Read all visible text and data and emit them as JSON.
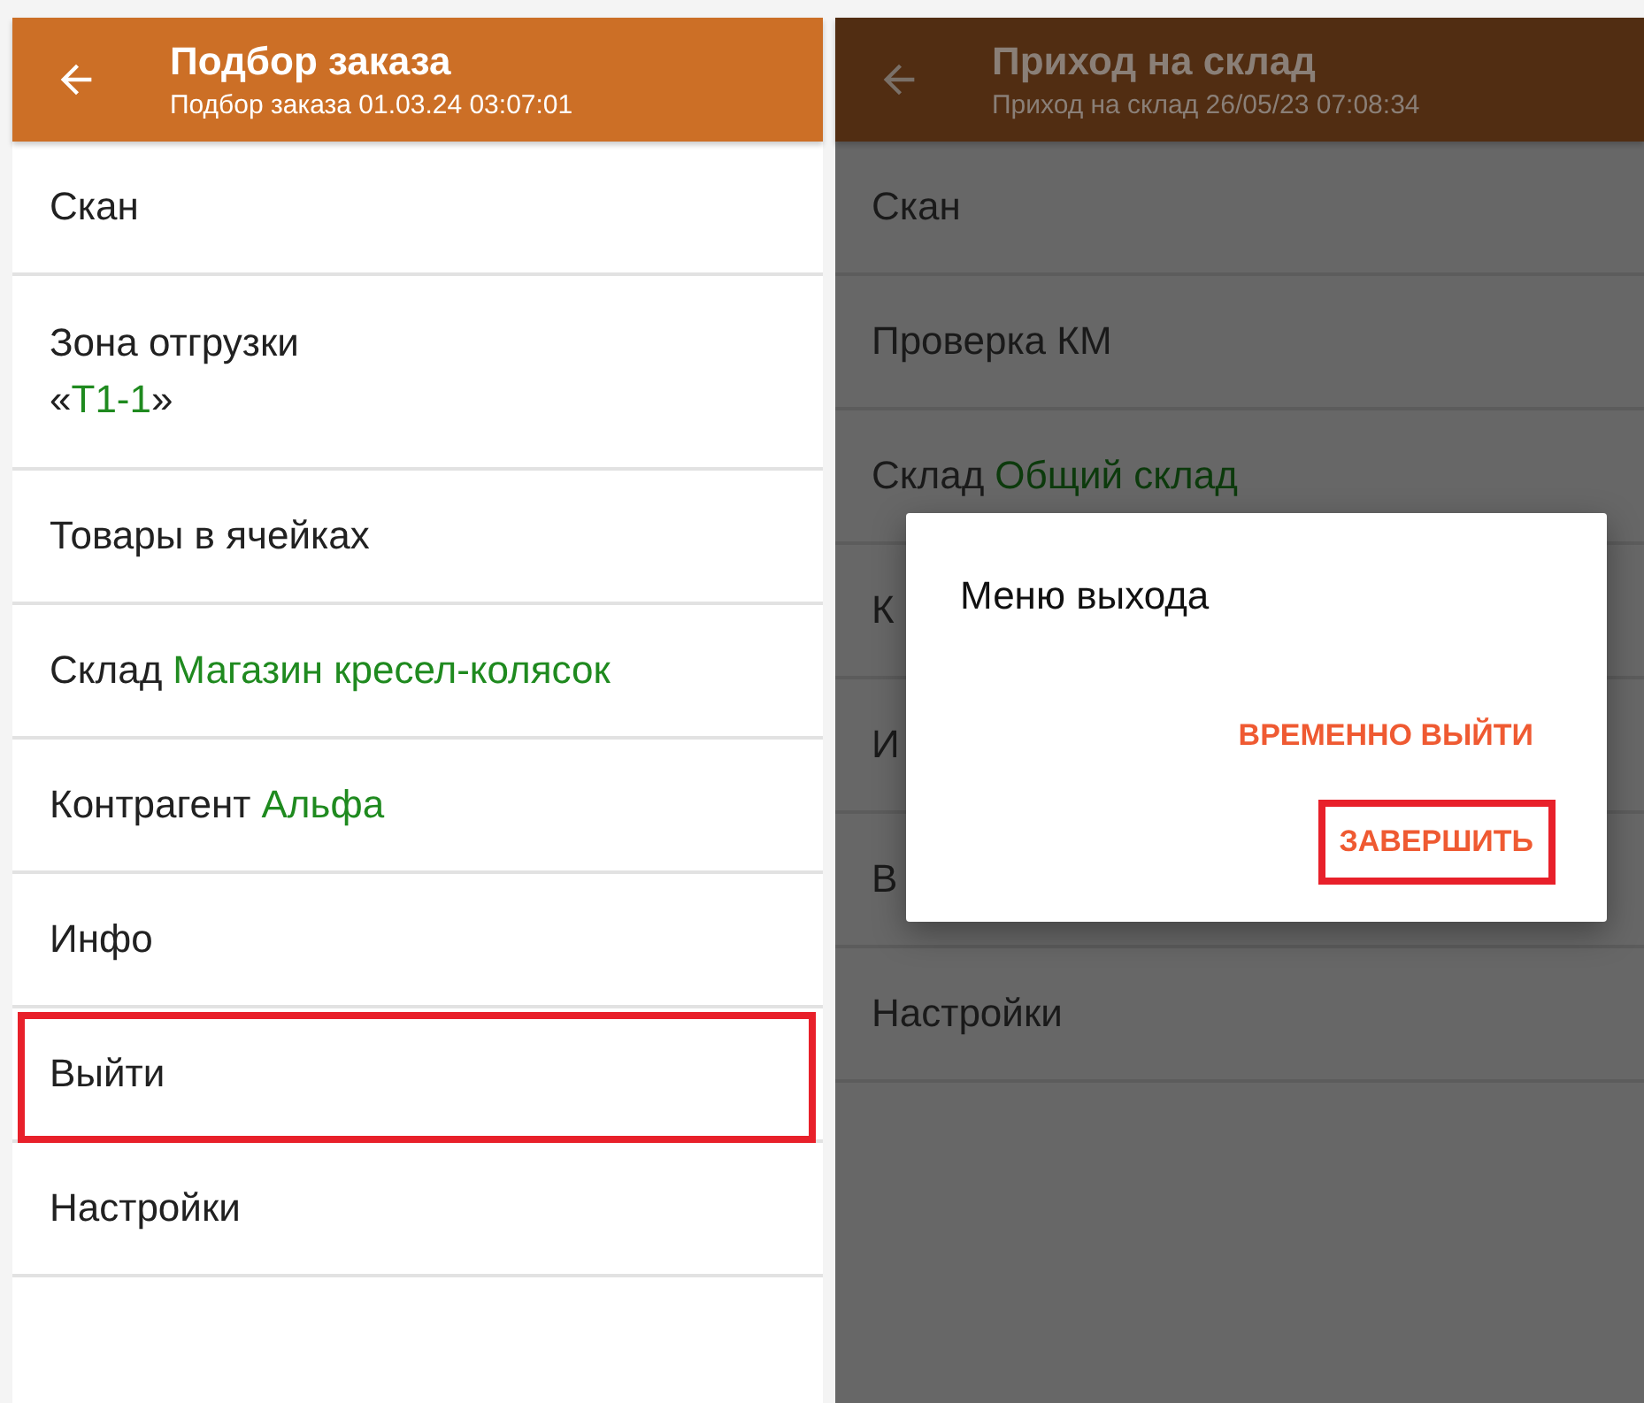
{
  "screens": [
    {
      "title": "Подбор заказа",
      "subtitle": "Подбор заказа 01.03.24 03:07:01",
      "dimmed": false,
      "items": [
        {
          "kind": "inline",
          "label": "Скан",
          "highlighted": false
        },
        {
          "kind": "two-line",
          "label": "Зона отгрузки",
          "quote_open": "«",
          "value": "Т1-1",
          "quote_close": "»",
          "highlighted": false
        },
        {
          "kind": "inline",
          "label": "Товары в ячейках",
          "highlighted": false
        },
        {
          "kind": "inline",
          "label": "Склад",
          "value": "Магазин кресел-колясок",
          "highlighted": false
        },
        {
          "kind": "inline",
          "label": "Контрагент",
          "value": "Альфа",
          "highlighted": false
        },
        {
          "kind": "inline",
          "label": "Инфо",
          "highlighted": false
        },
        {
          "kind": "inline",
          "label": "Выйти",
          "highlighted": true
        },
        {
          "kind": "inline",
          "label": "Настройки",
          "highlighted": false
        }
      ]
    },
    {
      "title": "Приход на склад",
      "subtitle": "Приход на склад 26/05/23 07:08:34",
      "dimmed": true,
      "items": [
        {
          "kind": "inline",
          "label": "Скан",
          "highlighted": false
        },
        {
          "kind": "inline",
          "label": "Проверка КМ",
          "highlighted": false
        },
        {
          "kind": "inline",
          "label": "Склад",
          "value": "Общий склад",
          "highlighted": false
        },
        {
          "kind": "inline",
          "label": "К",
          "highlighted": false
        },
        {
          "kind": "inline",
          "label": "И",
          "highlighted": false
        },
        {
          "kind": "inline",
          "label": "В",
          "highlighted": false
        },
        {
          "kind": "inline",
          "label": "Настройки",
          "highlighted": false
        }
      ],
      "dialog": {
        "title": "Меню выхода",
        "buttons": [
          {
            "label": "ВРЕМЕННО ВЫЙТИ",
            "highlighted": false
          },
          {
            "label": "ЗАВЕРШИТЬ",
            "highlighted": true
          }
        ]
      }
    }
  ]
}
